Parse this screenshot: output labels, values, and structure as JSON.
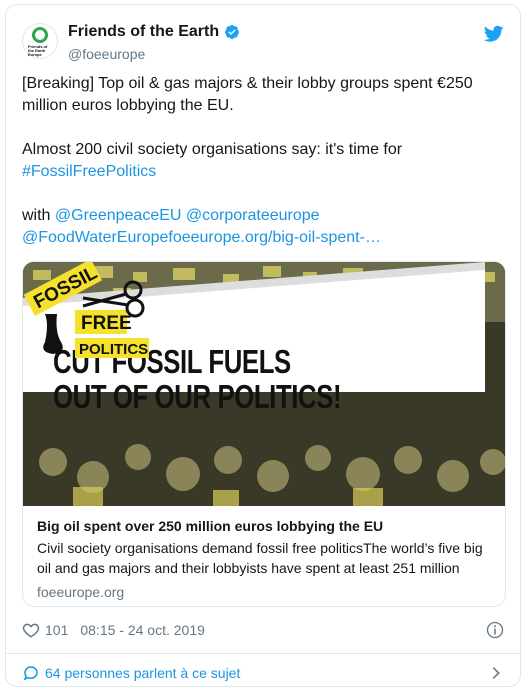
{
  "author": {
    "name": "Friends of the Earth",
    "handle": "@foeeurope",
    "avatar_text": "Friends of the Earth Europe",
    "verified": true
  },
  "tweet": {
    "line1": "[Breaking] Top oil & gas majors & their lobby groups spent €250 million euros lobbying the EU.",
    "line2_prefix": "Almost 200 civil society organisations say: it's time for ",
    "hashtag": "#FossilFreePolitics",
    "with_label": "with ",
    "mention1": "@GreenpeaceEU",
    "mention2": "@corporateeurope",
    "mention3_link": "@FoodWaterEuropefoeeurope.org/big-oil-spent-…"
  },
  "media": {
    "headline_line1": "CUT FOSSIL FUELS",
    "headline_line2": "OUT OF OUR POLITICS!",
    "badge_word1": "FOSSIL",
    "badge_word2": "FREE",
    "badge_word3": "POLITICS"
  },
  "link_card": {
    "title": "Big oil spent over 250 million euros lobbying the EU",
    "description": "Civil society organisations demand fossil free politicsThe world’s five big oil and gas majors and their lobbyists have spent at least 251 million",
    "domain": "foeeurope.org"
  },
  "meta": {
    "like_count": "101",
    "timestamp": "08:15 - 24 oct. 2019"
  },
  "footer": {
    "conversation_label": "64 personnes parlent à ce sujet"
  },
  "colors": {
    "link": "#1b95e0",
    "secondary": "#657786",
    "banner_yellow": "#f5e12b",
    "logo_green": "#2aa84a"
  }
}
